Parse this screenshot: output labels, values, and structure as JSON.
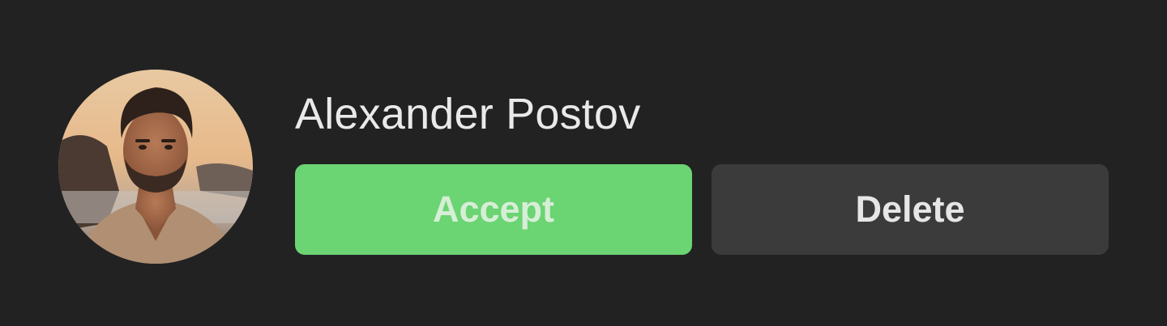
{
  "request": {
    "user_name": "Alexander Postov",
    "avatar": {
      "icon": "user-photo"
    },
    "actions": {
      "accept_label": "Accept",
      "delete_label": "Delete"
    }
  },
  "colors": {
    "background": "#222222",
    "accent": "#6bd473",
    "secondary_button": "#3b3b3b",
    "text": "#e9e9e9"
  }
}
